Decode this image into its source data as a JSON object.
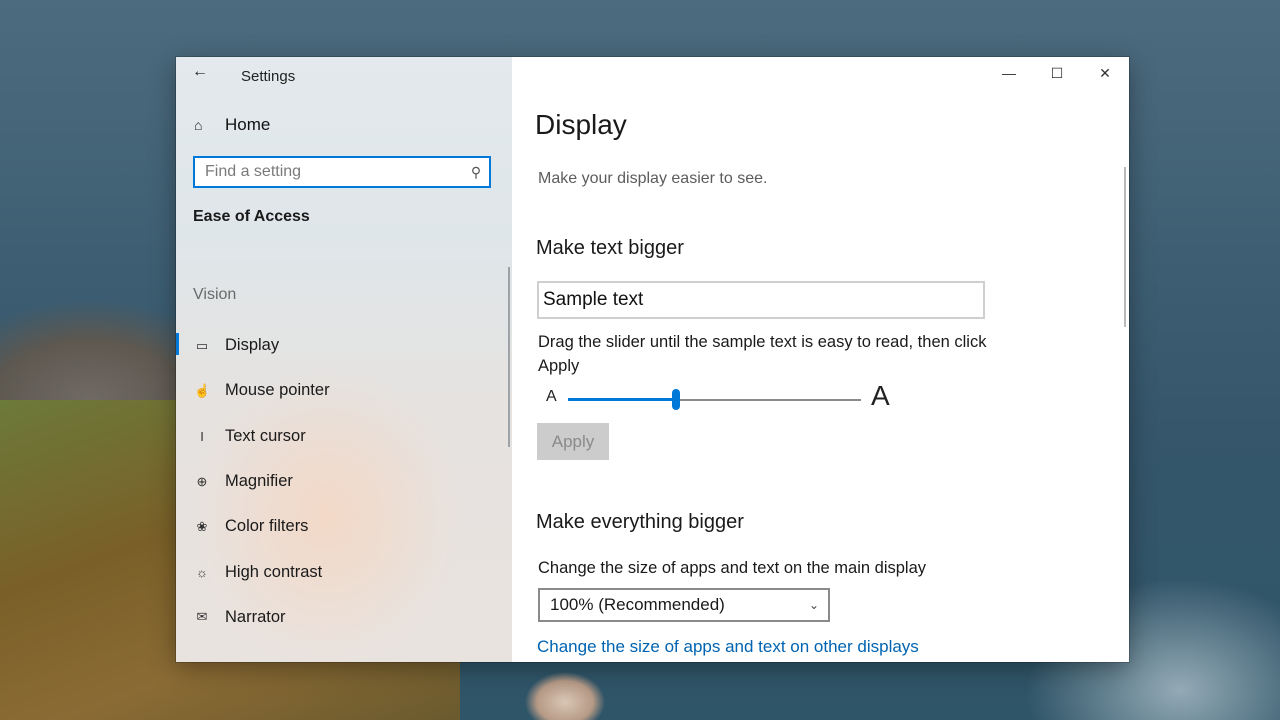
{
  "window": {
    "title": "Settings",
    "controls": {
      "minimize": "—",
      "maximize": "☐",
      "close": "✕"
    }
  },
  "sidebar": {
    "back_icon": "arrow-left",
    "home": {
      "label": "Home",
      "icon": "home-icon"
    },
    "search": {
      "placeholder": "Find a setting",
      "value": "",
      "icon": "search-icon"
    },
    "section_title": "Ease of Access",
    "group_title": "Vision",
    "items": [
      {
        "label": "Display",
        "icon": "monitor-icon",
        "selected": true
      },
      {
        "label": "Mouse pointer",
        "icon": "pointer-hand-icon",
        "selected": false
      },
      {
        "label": "Text cursor",
        "icon": "text-cursor-icon",
        "selected": false
      },
      {
        "label": "Magnifier",
        "icon": "magnifier-icon",
        "selected": false
      },
      {
        "label": "Color filters",
        "icon": "palette-icon",
        "selected": false
      },
      {
        "label": "High contrast",
        "icon": "brightness-icon",
        "selected": false
      },
      {
        "label": "Narrator",
        "icon": "narrator-icon",
        "selected": false
      }
    ]
  },
  "main": {
    "title": "Display",
    "subtitle": "Make your display easier to see.",
    "text_bigger": {
      "heading": "Make text bigger",
      "sample_text": "Sample text",
      "instruction": "Drag the slider until the sample text is easy to read, then click Apply",
      "slider_min_label": "A",
      "slider_max_label": "A",
      "slider_value": 0.37,
      "apply_label": "Apply",
      "apply_enabled": false
    },
    "everything_bigger": {
      "heading": "Make everything bigger",
      "description": "Change the size of apps and text on the main display",
      "scale_selected": "100% (Recommended)",
      "link_other_displays": "Change the size of apps and text on other displays"
    }
  },
  "colors": {
    "accent": "#0078d7",
    "link": "#0063b1"
  }
}
